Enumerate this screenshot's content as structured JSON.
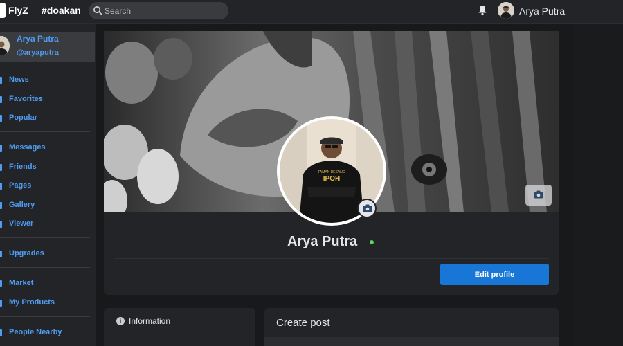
{
  "topbar": {
    "app_name": "FlyZ",
    "hashtag": "#doakan",
    "search_placeholder": "Search",
    "user_name": "Arya Putra"
  },
  "sidebar": {
    "profile": {
      "name": "Arya Putra",
      "handle": "@aryaputra"
    },
    "items": [
      {
        "label": "News",
        "icon": "news-icon"
      },
      {
        "label": "Favorites",
        "icon": "star-icon"
      },
      {
        "label": "Popular",
        "icon": "fire-icon"
      },
      {
        "label": "Messages",
        "icon": "message-icon"
      },
      {
        "label": "Friends",
        "icon": "friends-icon"
      },
      {
        "label": "Pages",
        "icon": "pages-icon"
      },
      {
        "label": "Gallery",
        "icon": "gallery-icon"
      },
      {
        "label": "Viewer",
        "icon": "eye-icon"
      },
      {
        "label": "Upgrades",
        "icon": "upgrade-icon"
      },
      {
        "label": "Market",
        "icon": "market-icon"
      },
      {
        "label": "My Products",
        "icon": "products-icon"
      },
      {
        "label": "People Nearby",
        "icon": "location-icon"
      }
    ]
  },
  "profile": {
    "name": "Arya Putra",
    "status": "online",
    "edit_label": "Edit profile",
    "shirt_text_top": "TAMAN DESANG",
    "shirt_text_main": "IPOH"
  },
  "info": {
    "title": "Information"
  },
  "create_post": {
    "title": "Create post"
  },
  "colors": {
    "accent": "#4f9cf0",
    "button": "#1877d6",
    "online": "#5fd35f",
    "background": "#18191b",
    "panel": "#232427"
  }
}
